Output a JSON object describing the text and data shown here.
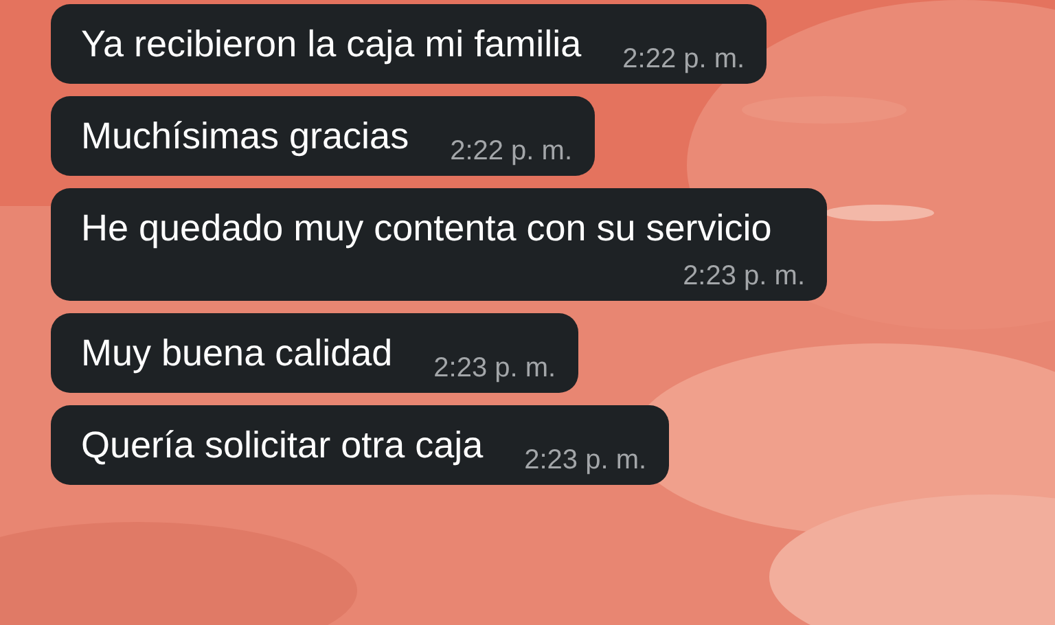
{
  "messages": [
    {
      "text": "Ya recibieron la caja mi familia",
      "time": "2:22 p. m."
    },
    {
      "text": "Muchísimas gracias",
      "time": "2:22 p. m."
    },
    {
      "text": "He quedado muy contenta con su servicio",
      "time": "2:23 p. m."
    },
    {
      "text": "Muy buena calidad",
      "time": "2:23 p. m."
    },
    {
      "text": "Quería solicitar otra caja",
      "time": "2:23 p. m."
    }
  ]
}
